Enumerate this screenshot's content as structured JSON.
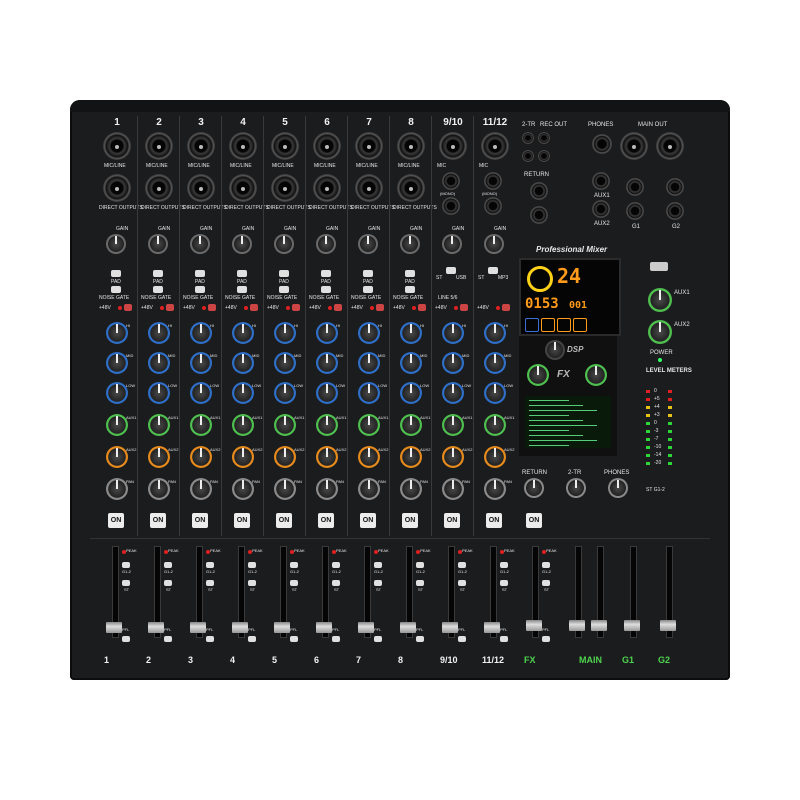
{
  "channels": [
    {
      "num": "1"
    },
    {
      "num": "2"
    },
    {
      "num": "3"
    },
    {
      "num": "4"
    },
    {
      "num": "5"
    },
    {
      "num": "6"
    },
    {
      "num": "7"
    },
    {
      "num": "8"
    },
    {
      "num": "9/10"
    },
    {
      "num": "11/12"
    }
  ],
  "fader_labels": [
    "1",
    "2",
    "3",
    "4",
    "5",
    "6",
    "7",
    "8",
    "9/10",
    "11/12",
    "FX",
    "MAIN",
    "G1",
    "G2"
  ],
  "labels": {
    "mic_line": "MIC/LINE",
    "direct_outputs": "DIRECT OUTPUTS",
    "mic": "MIC",
    "mono": "(MONO)",
    "gain": "GAIN",
    "pad": "PAD",
    "noise_gate": "NOISE GATE",
    "v48": "+48V",
    "hi": "HI",
    "mid": "MID",
    "low": "LOW",
    "aux1": "AUX1",
    "aux2": "AUX2",
    "pan": "PAN",
    "on": "ON",
    "peak": "PEAK",
    "st": "ST",
    "g12": "G1-2",
    "pfl": "PFL",
    "line56": "LINE 5/6",
    "usb": "USB",
    "mp3": "MP3",
    "two_tr": "2-TR",
    "rec_out": "REC OUT",
    "phones": "PHONES",
    "main_out": "MAIN OUT",
    "return": "RETURN",
    "g1": "G1",
    "g2": "G2",
    "l": "L",
    "r": "R",
    "professional_mixer": "Professional Mixer",
    "dsp": "DSP",
    "fx": "FX",
    "power": "POWER",
    "level_meters": "LEVEL METERS",
    "meter_db": [
      "0",
      "+5",
      "+4",
      "+3",
      "0",
      "-3",
      "-7",
      "-10",
      "-14",
      "-20"
    ],
    "st_g12": "ST",
    "g12b": "G1-2"
  },
  "lcd": {
    "track": "24",
    "time": "0153",
    "track2": "001"
  },
  "colors": {
    "body": "#1b1c1e",
    "knob_blue": "#2f6fc7",
    "knob_green": "#4fbf4f",
    "knob_orange": "#e58a1d",
    "knob_grey": "#6a6a6a",
    "lcd_orange": "#ff9a1a",
    "lcd_yellow": "#ffd21a",
    "led_red": "#e02020",
    "meter_green": "#2fd63a"
  }
}
